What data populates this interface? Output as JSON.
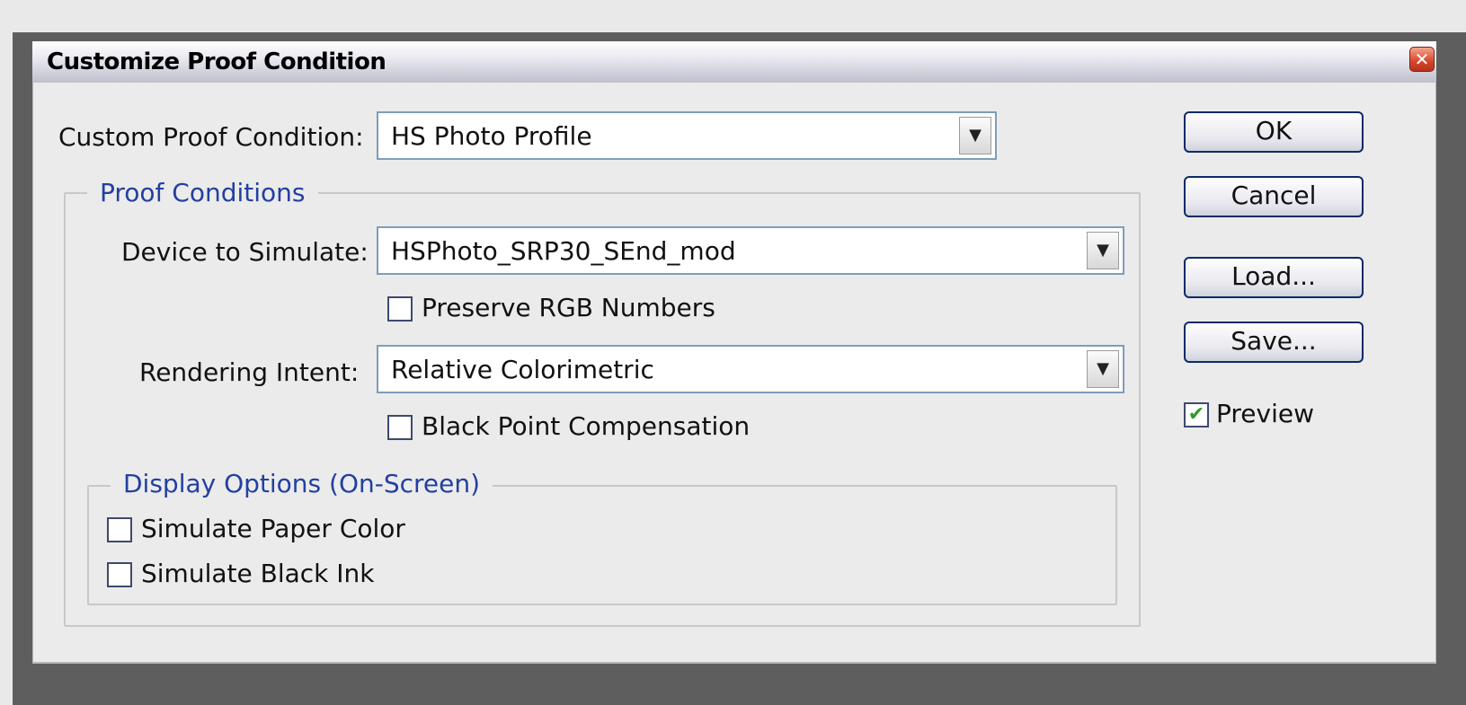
{
  "window": {
    "title": "Customize Proof Condition",
    "close_icon": "close-icon"
  },
  "custom_proof": {
    "label": "Custom Proof Condition:",
    "value": "HS Photo Profile"
  },
  "proof_conditions": {
    "title": "Proof Conditions",
    "device_label": "Device to Simulate:",
    "device_value": "HSPhoto_SRP30_SEnd_mod",
    "preserve_rgb_label": "Preserve RGB Numbers",
    "preserve_rgb_checked": false,
    "intent_label": "Rendering Intent:",
    "intent_value": "Relative Colorimetric",
    "bpc_label": "Black Point Compensation",
    "bpc_checked": false
  },
  "display_options": {
    "title": "Display Options (On-Screen)",
    "paper_color_label": "Simulate Paper Color",
    "paper_color_checked": false,
    "black_ink_label": "Simulate Black Ink",
    "black_ink_checked": false
  },
  "buttons": {
    "ok": "OK",
    "cancel": "Cancel",
    "load": "Load...",
    "save": "Save..."
  },
  "preview": {
    "label": "Preview",
    "checked": true,
    "check_glyph": "✔"
  },
  "combo_arrow_glyph": "▼",
  "close_glyph": "✕"
}
